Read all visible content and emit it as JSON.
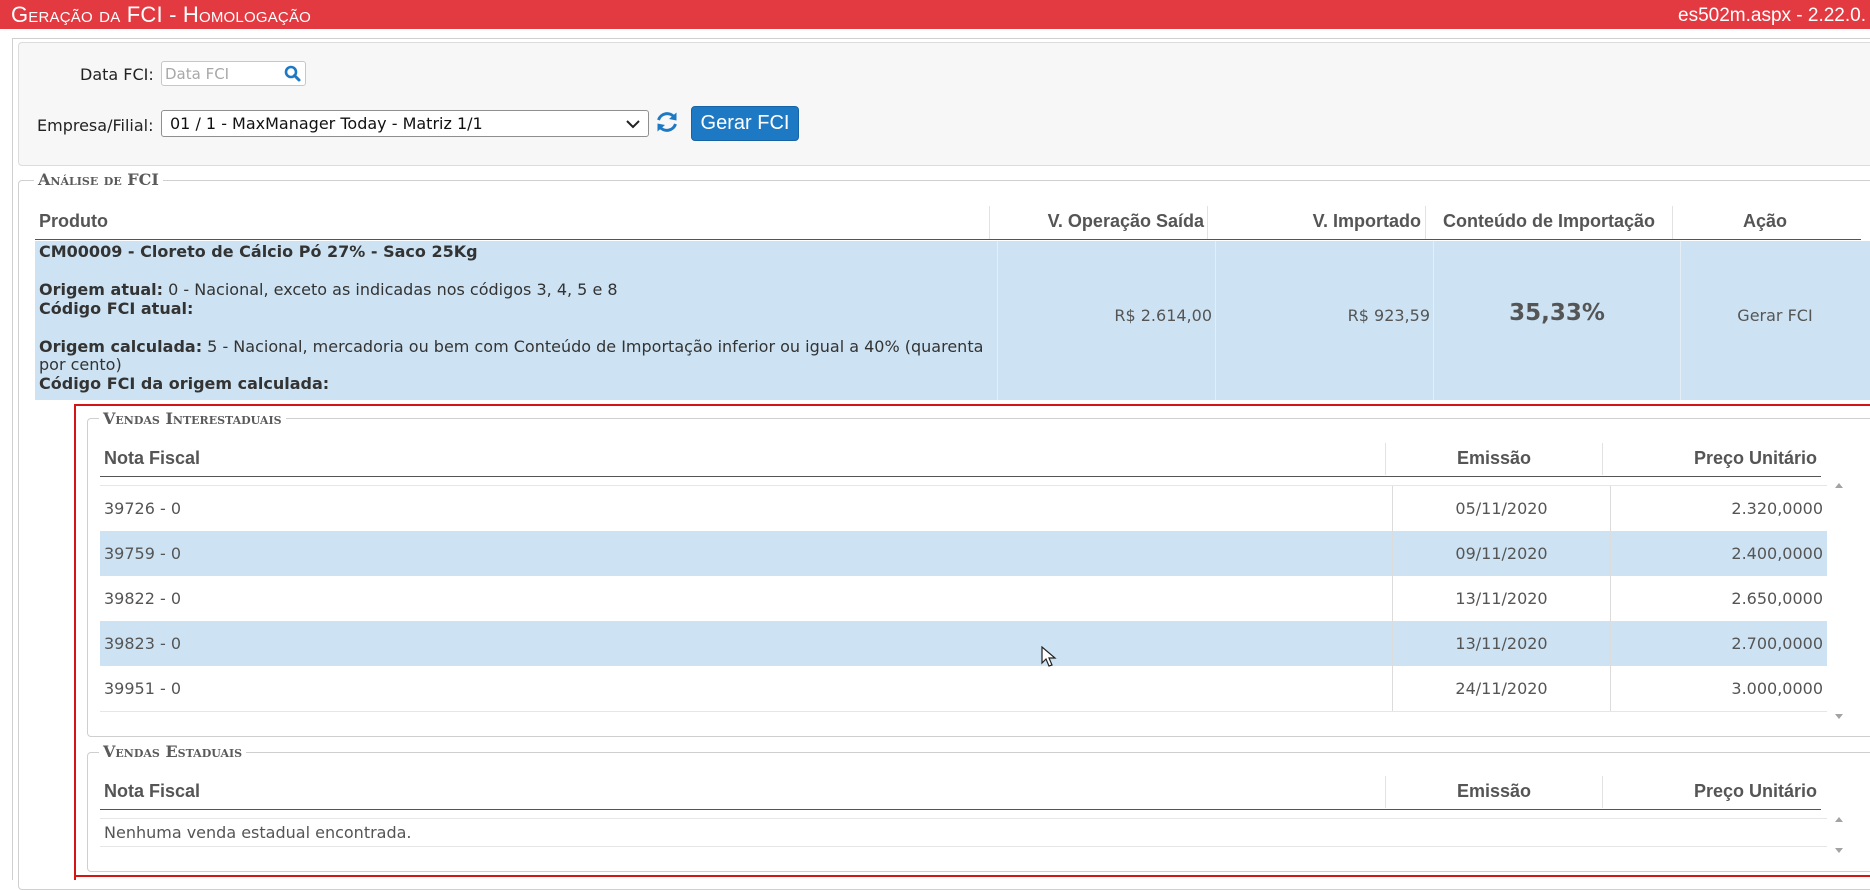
{
  "window": {
    "title": "Geração da FCI  - Homologação",
    "version": "es502m.aspx - 2.22.0."
  },
  "filters": {
    "date_label": "Data FCI:",
    "date_placeholder": "Data FCI",
    "company_label": "Empresa/Filial:",
    "company_value": "01 / 1 - MaxManager Today - Matriz 1/1",
    "generate_button": "Gerar FCI"
  },
  "analysis": {
    "legend": "Análise de FCI",
    "columns": [
      "Produto",
      "V. Operação Saída",
      "V. Importado",
      "Conteúdo de Importação",
      "Ação"
    ],
    "row": {
      "product": "CM00009 - Cloreto de Cálcio Pó 27% - Saco 25Kg",
      "origem_atual_label": "Origem atual:",
      "origem_atual_value": " 0 - Nacional, exceto as indicadas nos códigos 3, 4, 5 e 8",
      "codigo_fci_atual_label": "Código FCI atual:",
      "origem_calculada_label": "Origem calculada:",
      "origem_calculada_value": " 5 - Nacional, mercadoria ou bem com Conteúdo de Importação inferior ou igual a 40% (quarenta",
      "origem_calculada_value_cont": "por cento)",
      "codigo_fci_calculada_label": "Código FCI da origem calculada:",
      "v_operacao_saida": "R$ 2.614,00",
      "v_importado": "R$ 923,59",
      "conteudo_importacao": "35,33%",
      "acao": "Gerar FCI"
    }
  },
  "vendas_interestaduais": {
    "legend": "Vendas Interestaduais",
    "columns": [
      "Nota Fiscal",
      "Emissão",
      "Preço Unitário"
    ],
    "rows": [
      {
        "nota": "39726 - 0",
        "emissao": "05/11/2020",
        "preco": "2.320,0000"
      },
      {
        "nota": "39759 - 0",
        "emissao": "09/11/2020",
        "preco": "2.400,0000"
      },
      {
        "nota": "39822 - 0",
        "emissao": "13/11/2020",
        "preco": "2.650,0000"
      },
      {
        "nota": "39823 - 0",
        "emissao": "13/11/2020",
        "preco": "2.700,0000"
      },
      {
        "nota": "39951 - 0",
        "emissao": "24/11/2020",
        "preco": "3.000,0000"
      }
    ]
  },
  "vendas_estaduais": {
    "legend": "Vendas Estaduais",
    "columns": [
      "Nota Fiscal",
      "Emissão",
      "Preço Unitário"
    ],
    "empty_message": "Nenhuma venda estadual encontrada."
  },
  "colors": {
    "titlebar": "#e33a41",
    "button": "#1e79c4",
    "selected_row": "#cde3f3",
    "highlight_frame": "#d31515"
  }
}
